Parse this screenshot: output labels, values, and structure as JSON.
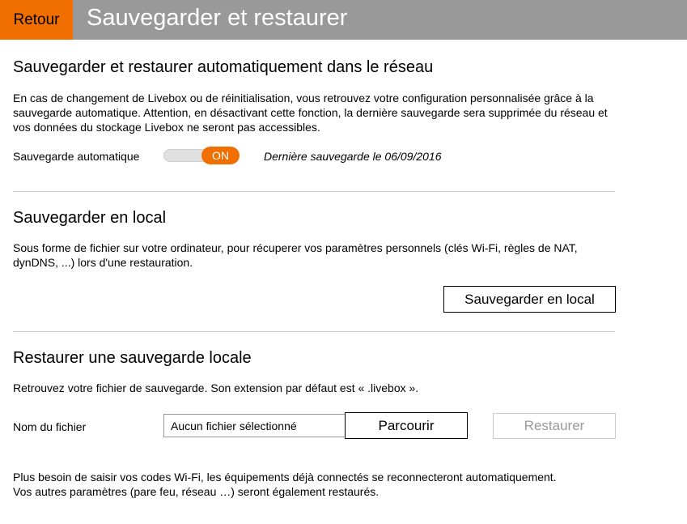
{
  "header": {
    "back_label": "Retour",
    "title": "Sauvegarder et restaurer"
  },
  "auto_section": {
    "title": "Sauvegarder et restaurer automatiquement dans le réseau",
    "description": "En cas de changement de Livebox ou de réinitialisation, vous retrouvez votre configuration personnalisée grâce à la sauvegarde automatique. Attention, en désactivant cette fonction, la dernière sauvegarde sera supprimée du réseau et vos données du stockage Livebox ne seront pas accessibles.",
    "toggle_label": "Sauvegarde automatique",
    "toggle_state": "ON",
    "last_save": "Dernière sauvegarde le 06/09/2016"
  },
  "local_section": {
    "title": "Sauvegarder en local",
    "description": "Sous forme de fichier sur votre ordinateur, pour récuperer vos paramètres personnels (clés Wi-Fi, règles de NAT, dynDNS, ...) lors d'une restauration.",
    "button_label": "Sauvegarder en local"
  },
  "restore_section": {
    "title": "Restaurer une sauvegarde locale",
    "description": "Retrouvez votre fichier de sauvegarde. Son extension par défaut est « .livebox ».",
    "file_label": "Nom du fichier",
    "file_value": "Aucun fichier sélectionné",
    "browse_label": "Parcourir",
    "restore_label": "Restaurer",
    "footer_line1": "Plus besoin de saisir vos codes Wi-Fi, les équipements déjà connectés se reconnecteront automatiquement.",
    "footer_line2": "Vos autres paramètres (pare feu, réseau …) seront également restaurés."
  },
  "colors": {
    "accent": "#f16e00",
    "header_bg": "#999999",
    "divider": "#cccccc",
    "disabled_text": "#9a9a9a"
  }
}
